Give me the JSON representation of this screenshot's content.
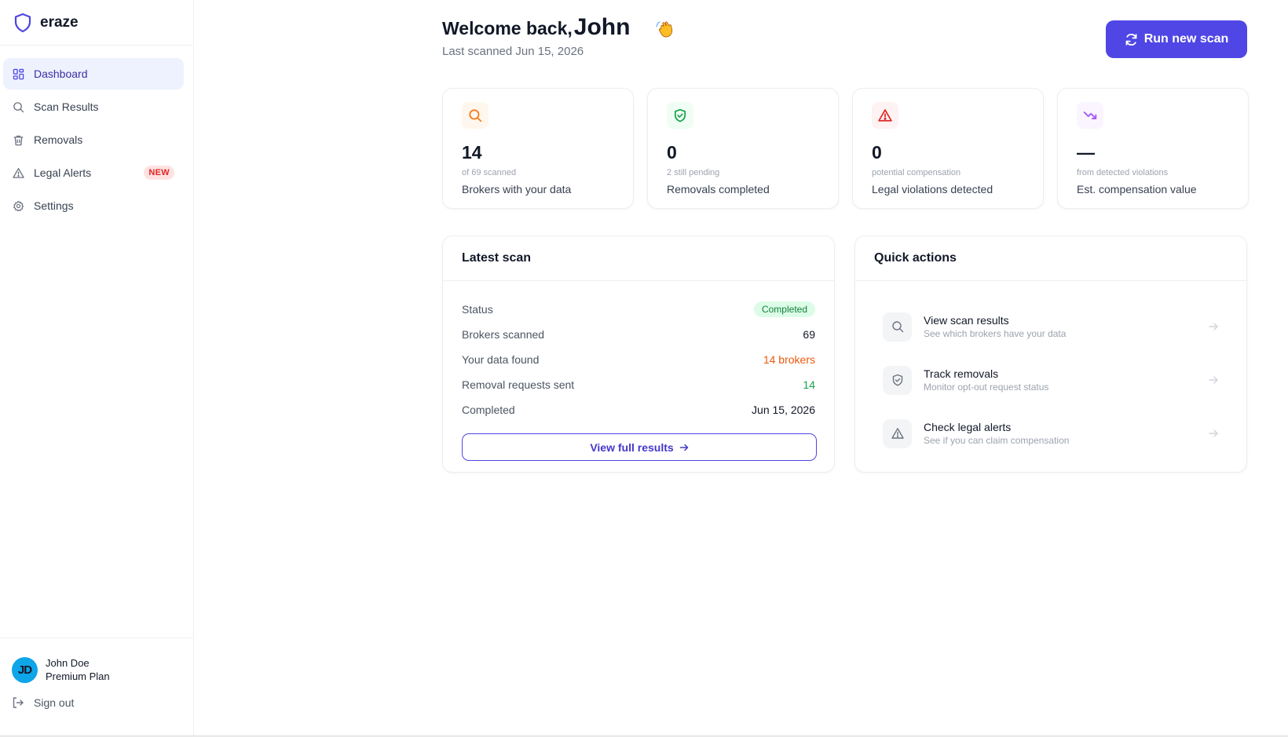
{
  "brand": {
    "name": "eraze"
  },
  "sidebar": {
    "items": [
      {
        "label": "Dashboard",
        "icon": "grid-icon",
        "active": true
      },
      {
        "label": "Scan Results",
        "icon": "search-icon"
      },
      {
        "label": "Removals",
        "icon": "trash-icon"
      },
      {
        "label": "Legal Alerts",
        "icon": "alert-triangle-icon",
        "badge": "NEW"
      },
      {
        "label": "Settings",
        "icon": "gear-icon"
      }
    ],
    "user": {
      "initials": "JD",
      "name": "John Doe",
      "plan": "Premium Plan"
    },
    "signout": "Sign out"
  },
  "header": {
    "welcome": "Welcome back,",
    "name": "John",
    "subtitle": "Last scanned Jun 15, 2026",
    "run_button": "Run new scan"
  },
  "stats": [
    {
      "value": "14",
      "sub": "of 69 scanned",
      "label": "Brokers with your data",
      "icon": "search-icon",
      "color": "#f97316",
      "bg": "#fff7ed"
    },
    {
      "value": "0",
      "sub": "2 still pending",
      "label": "Removals completed",
      "icon": "shield-check-icon",
      "color": "#16a34a",
      "bg": "#f0fdf4"
    },
    {
      "value": "0",
      "sub": "potential compensation",
      "label": "Legal violations detected",
      "icon": "alert-triangle-icon",
      "color": "#dc2626",
      "bg": "#fef2f2"
    },
    {
      "value": "—",
      "sub": "from detected violations",
      "label": "Est. compensation value",
      "icon": "trending-down-icon",
      "color": "#a855f7",
      "bg": "#faf5ff"
    }
  ],
  "latest_scan": {
    "title": "Latest scan",
    "status_label": "Status",
    "status_value": "Completed",
    "brokers_label": "Brokers scanned",
    "brokers_value": "69",
    "found_label": "Your data found",
    "found_value": "14 brokers",
    "sent_label": "Removal requests sent",
    "sent_value": "14",
    "completed_label": "Completed",
    "completed_value": "Jun 15, 2026",
    "button": "View full results"
  },
  "quick_actions": {
    "title": "Quick actions",
    "items": [
      {
        "title": "View scan results",
        "desc": "See which brokers have your data",
        "icon": "search-icon"
      },
      {
        "title": "Track removals",
        "desc": "Monitor opt-out request status",
        "icon": "shield-check-icon"
      },
      {
        "title": "Check legal alerts",
        "desc": "See if you can claim compensation",
        "icon": "alert-triangle-icon"
      }
    ]
  }
}
